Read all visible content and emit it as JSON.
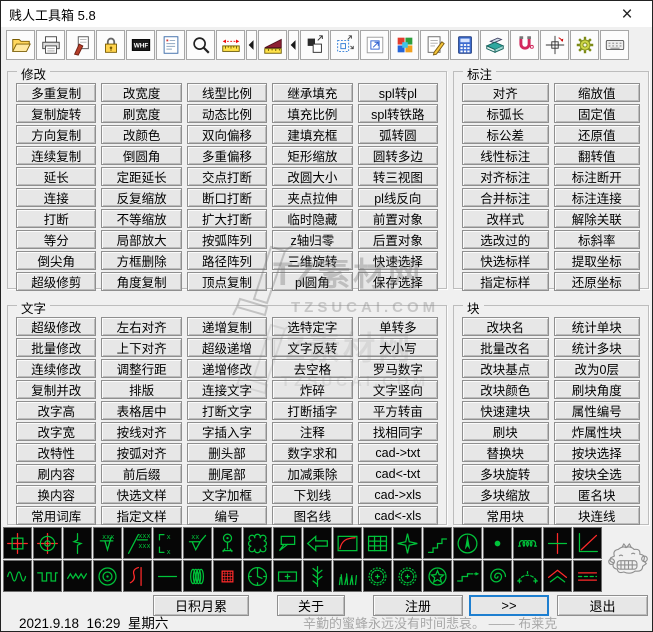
{
  "window": {
    "title": "贱人工具箱 5.8",
    "close_glyph": "×"
  },
  "toolbar": {
    "items": [
      "open-folder",
      "print",
      "purge-brush",
      "lock",
      "whf-text",
      "document-settings",
      "magnifier",
      "measure-ruler",
      "measure-flyout",
      "slope-wedge",
      "slope-flyout",
      "move-copy",
      "selection-box",
      "zoom-extents",
      "color-mosaic",
      "notepad-edit",
      "calculator",
      "notebooks",
      "magnet",
      "crosshair-target",
      "gear",
      "keyboard"
    ]
  },
  "sections": {
    "modify": {
      "title": "修改",
      "columns": [
        [
          "多重复制",
          "复制旋转",
          "方向复制",
          "连续复制",
          "延长",
          "连接",
          "打断",
          "等分",
          "倒尖角",
          "超级修剪"
        ],
        [
          "改宽度",
          "刷宽度",
          "改颜色",
          "倒圆角",
          "定距延长",
          "反复缩放",
          "不等缩放",
          "局部放大",
          "方框删除",
          "角度复制"
        ],
        [
          "线型比例",
          "动态比例",
          "双向偏移",
          "多重偏移",
          "交点打断",
          "断口打断",
          "扩大打断",
          "按弧阵列",
          "路径阵列",
          "顶点复制"
        ],
        [
          "继承填充",
          "填充比例",
          "建填充框",
          "矩形缩放",
          "改圆大小",
          "夹点拉伸",
          "临时隐藏",
          "z轴归零",
          "三维旋转",
          "pl圆角"
        ],
        [
          "spl转pl",
          "spl转铁路",
          "弧转圆",
          "圆转多边",
          "转三视图",
          "pl线反向",
          "前置对象",
          "后置对象",
          "快速选择",
          "保存选择"
        ]
      ]
    },
    "dimension": {
      "title": "标注",
      "columns": [
        [
          "对齐",
          "标弧长",
          "标公差",
          "线性标注",
          "对齐标注",
          "合并标注",
          "改样式",
          "选改过的",
          "快选标样",
          "指定标样"
        ],
        [
          "缩放值",
          "固定值",
          "还原值",
          "翻转值",
          "标注断开",
          "标注连接",
          "解除关联",
          "标斜率",
          "提取坐标",
          "还原坐标"
        ]
      ]
    },
    "text": {
      "title": "文字",
      "columns": [
        [
          "超级修改",
          "批量修改",
          "连续修改",
          "复制并改",
          "改字高",
          "改字宽",
          "改特性",
          "刷内容",
          "换内容",
          "常用词库"
        ],
        [
          "左右对齐",
          "上下对齐",
          "调整行距",
          "排版",
          "表格居中",
          "按线对齐",
          "按弧对齐",
          "前后缀",
          "快选文样",
          "指定文样"
        ],
        [
          "递增复制",
          "超级递增",
          "递增修改",
          "连接文字",
          "打断文字",
          "字插入字",
          "删头部",
          "删尾部",
          "文字加框",
          "编号"
        ],
        [
          "选特定字",
          "文字反转",
          "去空格",
          "炸碎",
          "打断插字",
          "注释",
          "数字求和",
          "加减乘除",
          "下划线",
          "图名线"
        ],
        [
          "单转多",
          "大小写",
          "罗马数字",
          "文字竖向",
          "平方转亩",
          "找相同字",
          "cad->txt",
          "cad<-txt",
          "cad->xls",
          "cad<-xls"
        ]
      ]
    },
    "block": {
      "title": "块",
      "columns": [
        [
          "改块名",
          "批量改名",
          "改块基点",
          "改块颜色",
          "快速建块",
          "刷块",
          "替换块",
          "多块旋转",
          "多块缩放",
          "常用块"
        ],
        [
          "统计单块",
          "统计多块",
          "改为0层",
          "刷块角度",
          "属性编号",
          "炸属性块",
          "按块选择",
          "按块全选",
          "匿名块",
          "块连线"
        ]
      ]
    }
  },
  "icon_strip": {
    "row1": [
      "point-square",
      "point-circle",
      "break-symbol",
      "roughness-xxx",
      "slope-ratio",
      "coordinate-label",
      "roughness-check",
      "datum-target",
      "revision-cloud",
      "leader-callout",
      "arrow-left",
      "curve-chart",
      "table-grid",
      "star-four",
      "step-line",
      "north-arrow",
      "point-dot",
      "coil-small",
      "cross-mark",
      "axis-chart"
    ],
    "row2": [
      "sine-wave",
      "square-wave",
      "zigzag-wave",
      "concentric-circles",
      "section-hook",
      "straight-line",
      "spring-coil",
      "hatch-square",
      "clock",
      "rect-plus",
      "tree-branch",
      "grass",
      "burst-star-a",
      "burst-star-b",
      "circle-star",
      "step-arrow",
      "spiral",
      "arc-dots",
      "roof-peak",
      "track-lines"
    ]
  },
  "footer": {
    "buttons": [
      "日积月累",
      "关于",
      "注册",
      ">>",
      "退出"
    ],
    "focused": ">>"
  },
  "statusbar": {
    "datetime": "2021.9.18  16:29  星期六",
    "quote": "辛勤的蜜蜂永远没有时间悲哀。 —— 布莱克"
  },
  "watermark": {
    "line1": "TZ素材网",
    "line2": "TZSUCAI.COM"
  },
  "colors": {
    "accent": "#1e7fd0",
    "icon_green": "#00c33a",
    "icon_red": "#ff2a2a",
    "window_bg": "#f0f0f0"
  }
}
